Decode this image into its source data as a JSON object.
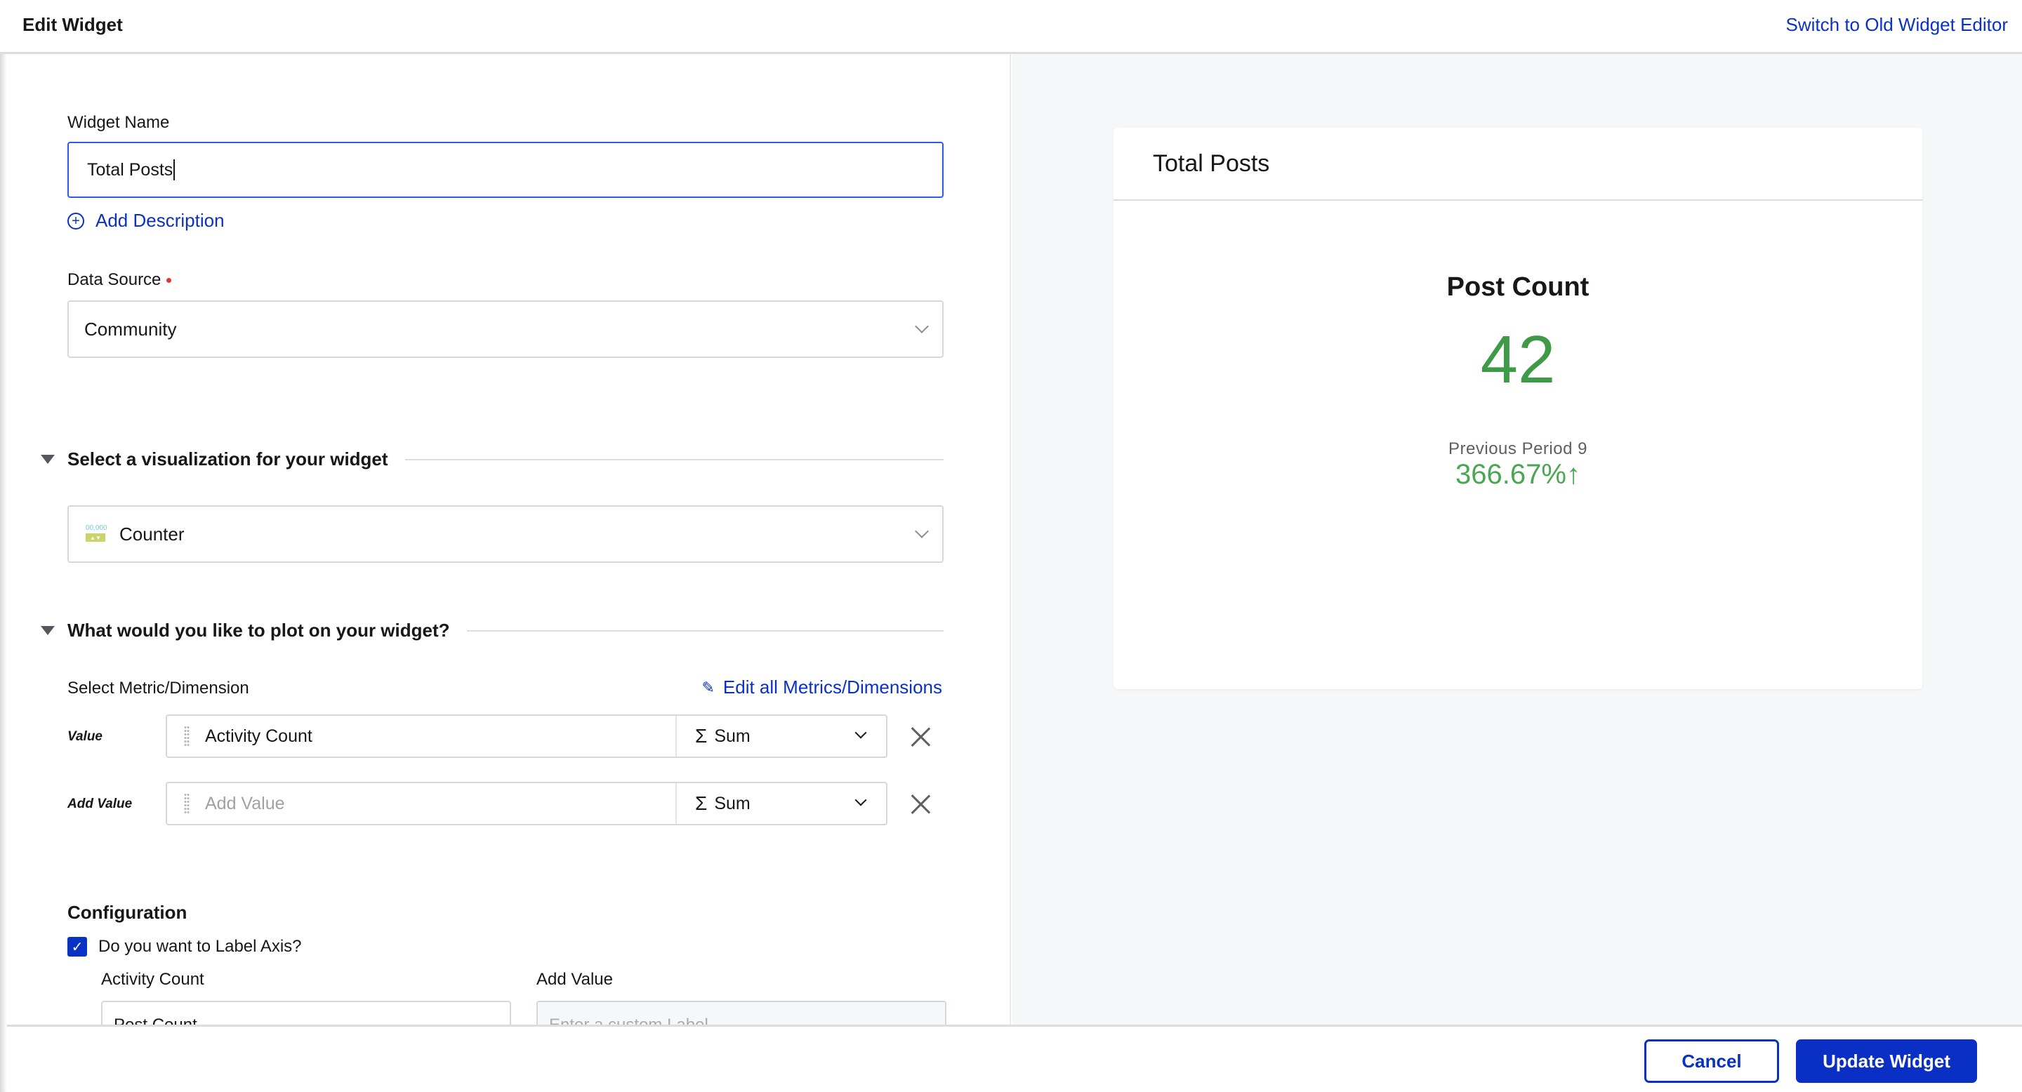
{
  "header": {
    "title": "Edit Widget",
    "switch_link": "Switch to Old Widget Editor"
  },
  "form": {
    "widget_name": {
      "label": "Widget Name",
      "value": "Total Posts"
    },
    "add_description": "Add Description",
    "data_source": {
      "label": "Data Source",
      "required": true,
      "value": "Community"
    },
    "visualization_section": {
      "title": "Select a visualization for your widget",
      "selected": "Counter",
      "icon": "counter-icon",
      "icon_digits": "00,000",
      "icon_arrows": "▲▼"
    },
    "plot_section": {
      "title": "What would you like to plot on your widget?",
      "select_label": "Select Metric/Dimension",
      "edit_all": "Edit all Metrics/Dimensions",
      "rows": [
        {
          "label": "Value",
          "value": "Activity Count",
          "placeholder": "",
          "aggregation": "Sum",
          "sigma": "Σ"
        },
        {
          "label": "Add Value",
          "value": "",
          "placeholder": "Add Value",
          "aggregation": "Sum",
          "sigma": "Σ"
        }
      ]
    },
    "configuration": {
      "title": "Configuration",
      "label_axis_checkbox": {
        "label": "Do you want to Label Axis?",
        "checked": true,
        "check_glyph": "✓"
      },
      "axis_labels": [
        {
          "label": "Activity Count",
          "value": "Post Count",
          "placeholder": ""
        },
        {
          "label": "Add Value",
          "value": "",
          "placeholder": "Enter a custom Label"
        }
      ]
    }
  },
  "preview": {
    "card_title": "Total Posts",
    "metric_title": "Post Count",
    "value": "42",
    "previous_period_label": "Previous Period 9",
    "change": "366.67%",
    "change_arrow": "↑",
    "colors": {
      "value": "#3f9a48",
      "change": "#4aa653"
    }
  },
  "footer": {
    "cancel": "Cancel",
    "update": "Update Widget"
  },
  "colors": {
    "accent": "#0a32c2",
    "focus_border": "#2b5ce6",
    "required": "#d83a3a"
  }
}
